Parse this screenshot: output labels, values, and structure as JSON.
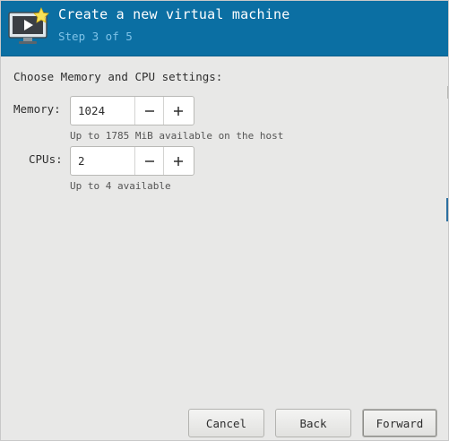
{
  "header": {
    "title": "Create a new virtual machine",
    "step": "Step 3 of 5",
    "icon": "virtual-machine-wizard-icon"
  },
  "main": {
    "heading": "Choose Memory and CPU settings:",
    "memory": {
      "label": "Memory:",
      "value": "1024",
      "hint": "Up to 1785 MiB available on the host"
    },
    "cpus": {
      "label": "CPUs:",
      "value": "2",
      "hint": "Up to 4 available"
    }
  },
  "footer": {
    "cancel_label": "Cancel",
    "back_label": "Back",
    "forward_label": "Forward"
  },
  "colors": {
    "header_bg": "#0b6fa3",
    "header_step": "#7fc3e8",
    "window_bg": "#e8e8e7"
  }
}
